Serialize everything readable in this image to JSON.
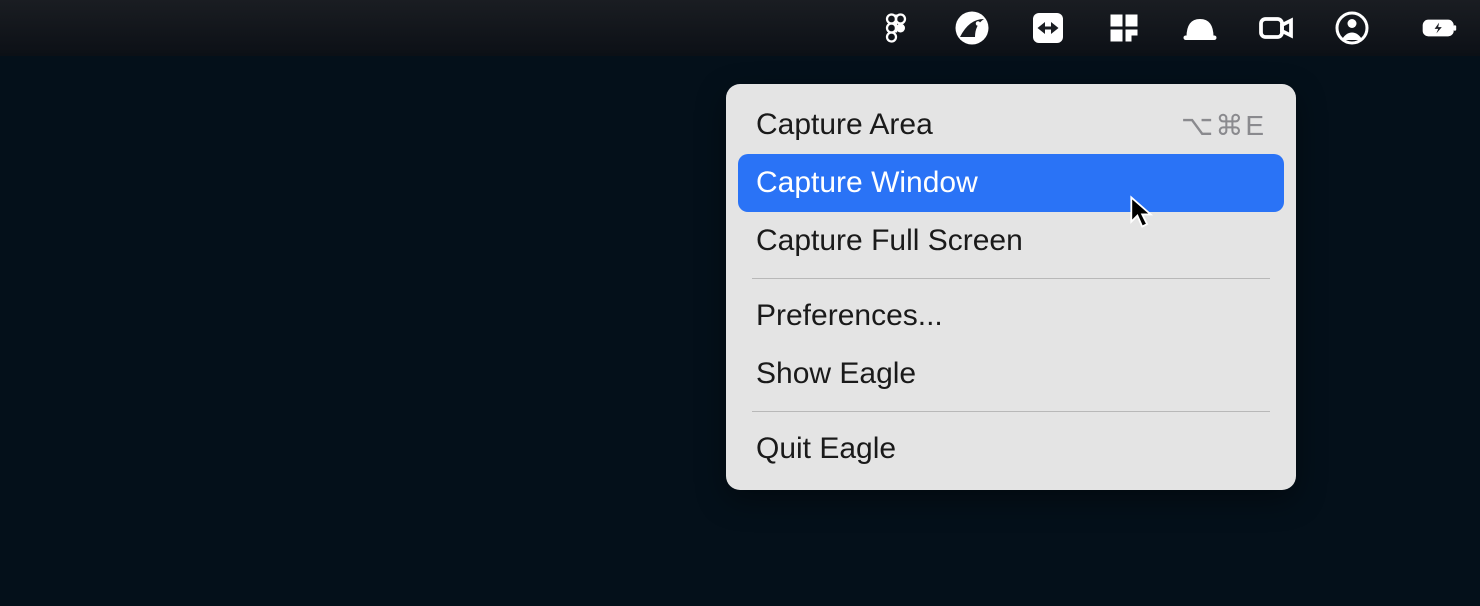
{
  "menubar": {
    "icons": [
      "figma-icon",
      "eagle-icon",
      "teamviewer-icon",
      "grid-icon",
      "helmet-icon",
      "camera-icon",
      "user-icon",
      "battery-charging-icon"
    ]
  },
  "dropdown": {
    "items": [
      {
        "label": "Capture Area",
        "shortcut": "⌥⌘E",
        "highlighted": false
      },
      {
        "label": "Capture Window",
        "shortcut": "",
        "highlighted": true
      },
      {
        "label": "Capture Full Screen",
        "shortcut": "",
        "highlighted": false
      }
    ],
    "section2": [
      {
        "label": "Preferences..."
      },
      {
        "label": "Show Eagle"
      }
    ],
    "section3": [
      {
        "label": "Quit Eagle"
      }
    ]
  }
}
